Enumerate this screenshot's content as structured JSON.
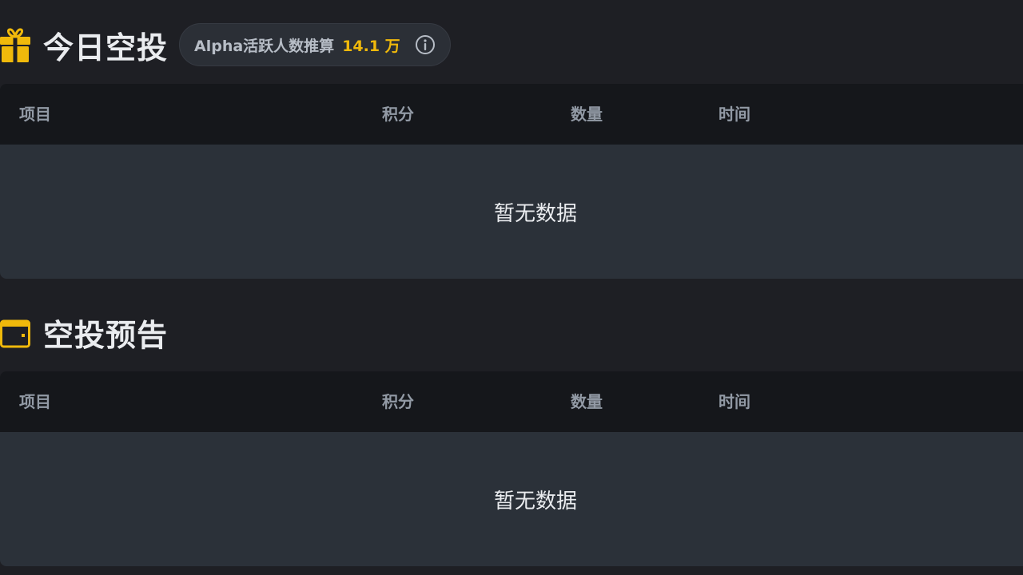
{
  "today_airdrop": {
    "title": "今日空投",
    "icon": "gift-icon",
    "stat": {
      "label": "Alpha活跃人数推算",
      "value": "14.1 万"
    },
    "columns": [
      "项目",
      "积分",
      "数量",
      "时间"
    ],
    "empty_text": "暂无数据"
  },
  "airdrop_preview": {
    "title": "空投预告",
    "icon": "calendar-icon",
    "columns": [
      "项目",
      "积分",
      "数量",
      "时间"
    ],
    "empty_text": "暂无数据"
  },
  "colors": {
    "accent": "#f0b90b",
    "background": "#1e1f24",
    "table_header": "#15171b",
    "table_body": "#2b3139",
    "muted_text": "#929aa5"
  }
}
